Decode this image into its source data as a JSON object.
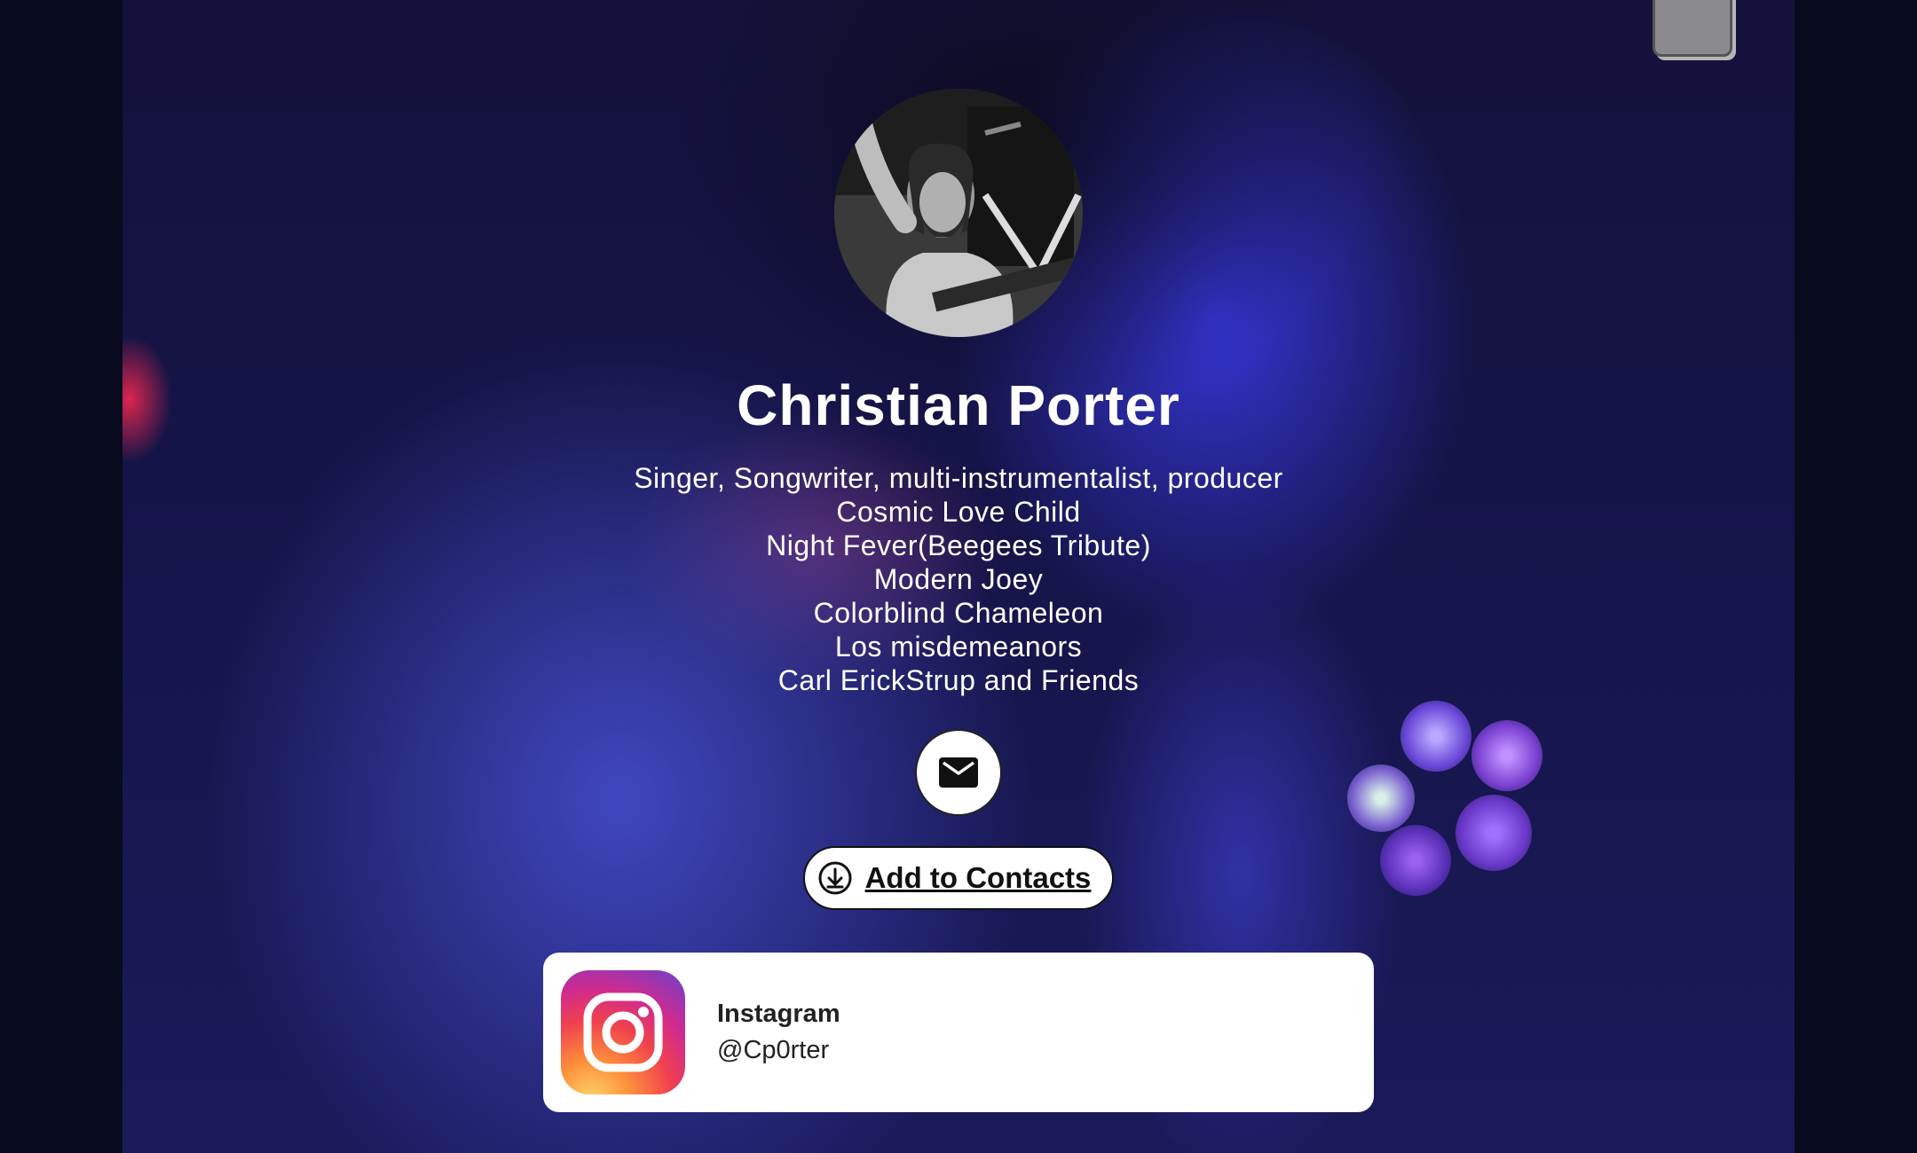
{
  "profile": {
    "name": "Christian Porter",
    "bio_lines": [
      "Singer, Songwriter, multi-instrumentalist, producer",
      "Cosmic Love Child",
      "Night Fever(Beegees Tribute)",
      "Modern Joey",
      "Colorblind Chameleon",
      "Los misdemeanors",
      "Carl ErickStrup and Friends"
    ]
  },
  "actions": {
    "email_icon": "envelope-icon",
    "add_contacts_label": "Add to Contacts",
    "add_contacts_icon": "download-circle-icon"
  },
  "links": [
    {
      "icon": "instagram-icon",
      "title": "Instagram",
      "handle": "@Cp0rter"
    }
  ],
  "colors": {
    "page_background": "#07081c",
    "backdrop_blue": "#1a1a5a",
    "card_background": "#ffffff",
    "text_light": "#ffffff",
    "text_dark": "#222222"
  }
}
